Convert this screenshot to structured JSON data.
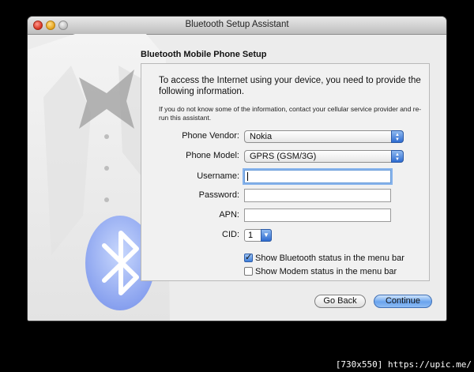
{
  "window": {
    "title": "Bluetooth Setup Assistant",
    "accent_color": "#3a78d8"
  },
  "content": {
    "section_title": "Bluetooth Mobile Phone Setup",
    "intro": "To access the Internet using your device, you need to provide the following information.",
    "note": "If you do not know some of the information, contact your cellular service provider and re-run this assistant."
  },
  "form": {
    "phone_vendor": {
      "label": "Phone Vendor:",
      "value": "Nokia"
    },
    "phone_model": {
      "label": "Phone Model:",
      "value": "GPRS (GSM/3G)"
    },
    "username": {
      "label": "Username:",
      "value": ""
    },
    "password": {
      "label": "Password:",
      "value": ""
    },
    "apn": {
      "label": "APN:",
      "value": ""
    },
    "cid": {
      "label": "CID:",
      "value": "1"
    },
    "show_bluetooth_status": {
      "label": "Show Bluetooth status in the menu bar",
      "checked": true
    },
    "show_modem_status": {
      "label": "Show Modem status in the menu bar",
      "checked": false
    }
  },
  "buttons": {
    "go_back": "Go Back",
    "continue": "Continue"
  },
  "footer": {
    "watermark": "[730x550] https://upic.me/"
  },
  "icons": [
    "close-icon",
    "minimize-icon",
    "zoom-icon",
    "bluetooth-icon",
    "tuxedo-illustration",
    "chevron-updown-icon"
  ]
}
